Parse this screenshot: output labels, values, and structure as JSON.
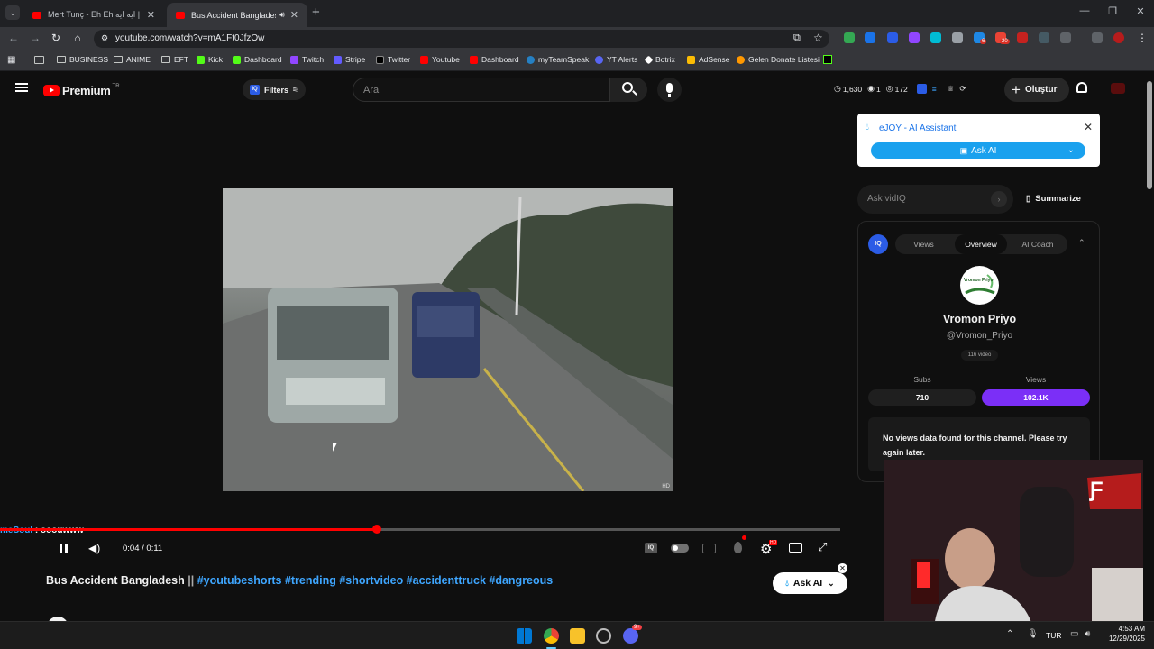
{
  "browser": {
    "tabs": [
      {
        "title": "Mert Tunç - Eh Eh ايه ايه | Arabic",
        "active": false
      },
      {
        "title": "Bus Accident Bangladesh ||",
        "active": true
      }
    ],
    "url": "youtube.com/watch?v=mA1Ft0JfzOw",
    "bookmarks": [
      "BUSINESS",
      "ANIME",
      "EFT",
      "Kick",
      "Dashboard",
      "Twitch",
      "Stripe",
      "Twitter",
      "Youtube",
      "Dashboard",
      "myTeamSpeak",
      "YT Alerts",
      "Botrix",
      "AdSense",
      "Gelen Donate Listesi"
    ],
    "ext_badges": {
      "notif1": "6",
      "notif2": "20"
    }
  },
  "youtube": {
    "logo_text": "Premium",
    "logo_region": "TR",
    "filters_label": "Filters",
    "search_placeholder": "Ara",
    "stats": {
      "history": "1,630",
      "watching": "1",
      "views": "172"
    },
    "create_label": "Oluştur"
  },
  "player": {
    "chat_user": "meSoul",
    "chat_message": ": ooouwww",
    "time_current": "0:04",
    "time_sep": " / ",
    "time_total": "0:11",
    "progress": 0.449,
    "quality_badge": "HD"
  },
  "video": {
    "title": "Bus Accident Bangladesh",
    "title_sep": " || ",
    "hashtags": "#youtubeshorts #trending #shortvideo #accidenttruck #dangreous",
    "ask_ai_label": "Ask AI"
  },
  "ejoy": {
    "title": "eJOY - AI Assistant",
    "ask_label": "Ask AI"
  },
  "vidiq": {
    "ask_placeholder": "Ask vidIQ",
    "summarize_label": "Summarize",
    "tabs": [
      "Views",
      "Overview",
      "AI Coach"
    ],
    "active_tab": "Overview",
    "channel_name": "Vromon Priyo",
    "channel_handle": "@Vromon_Priyo",
    "channel_avatar_text": "Vromon Priyo",
    "video_count": "116 video",
    "subs_label": "Subs",
    "subs_value": "710",
    "views_label": "Views",
    "views_value": "102.1K",
    "no_data_message": "No views data found for this channel. Please try again later.",
    "badge": "IQ"
  },
  "taskbar": {
    "lang": "TUR",
    "time": "4:53 AM",
    "date": "12/29/2025",
    "discord_badge": "9+"
  },
  "colors": {
    "yt_red": "#ff0000",
    "accent_blue": "#3ea6ff",
    "vidiq_purple": "#7b2ff7",
    "ejoy_blue": "#1aa1ee"
  }
}
